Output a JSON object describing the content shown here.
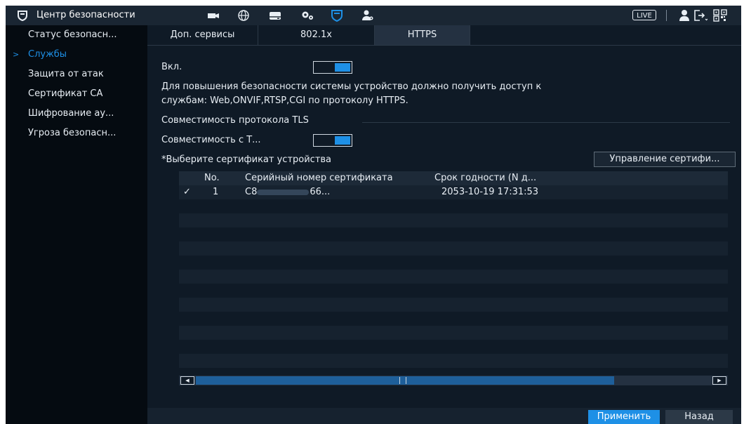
{
  "header": {
    "title": "Центр безопасности",
    "live": "LIVE",
    "nav_icons": [
      "camera-icon",
      "network-icon",
      "storage-icon",
      "settings-icon",
      "security-icon",
      "account-icon"
    ],
    "active_nav_icon": "security-icon",
    "right_icons": [
      "user-icon",
      "logout-icon",
      "qr-code-icon"
    ],
    "accent": "#1e90e6"
  },
  "sidebar": {
    "items": [
      {
        "label": "Статус безопасн..."
      },
      {
        "label": "Службы",
        "active": true
      },
      {
        "label": "Защита от атак"
      },
      {
        "label": "Сертификат СА"
      },
      {
        "label": "Шифрование ау..."
      },
      {
        "label": "Угроза безопасн..."
      }
    ]
  },
  "tabs": [
    {
      "label": "Доп. сервисы"
    },
    {
      "label": "802.1x"
    },
    {
      "label": "HTTPS",
      "active": true
    }
  ],
  "form": {
    "enable_label": "Вкл.",
    "enable_on": true,
    "info_line1": "Для повышения безопасности системы устройство должно получить доступ к",
    "info_line2": "службам: Web,ONVIF,RTSP,CGI по протоколу HTTPS.",
    "tls_section": "Совместимость протокола TLS",
    "compat_label": "Совместимость с Т...",
    "compat_on": true,
    "cert_label": "*Выберите сертификат устройства",
    "manage_button": "Управление сертифи..."
  },
  "table": {
    "headers": [
      "No.",
      "Серийный номер сертификата",
      "Срок годности (N д..."
    ],
    "rows": [
      {
        "selected": true,
        "no": "1",
        "serial_prefix": "C8",
        "serial_suffix": "66...",
        "expiry": "2053-10-19 17:31:53"
      }
    ]
  },
  "buttons": {
    "apply": "Применить",
    "back": "Назад"
  }
}
